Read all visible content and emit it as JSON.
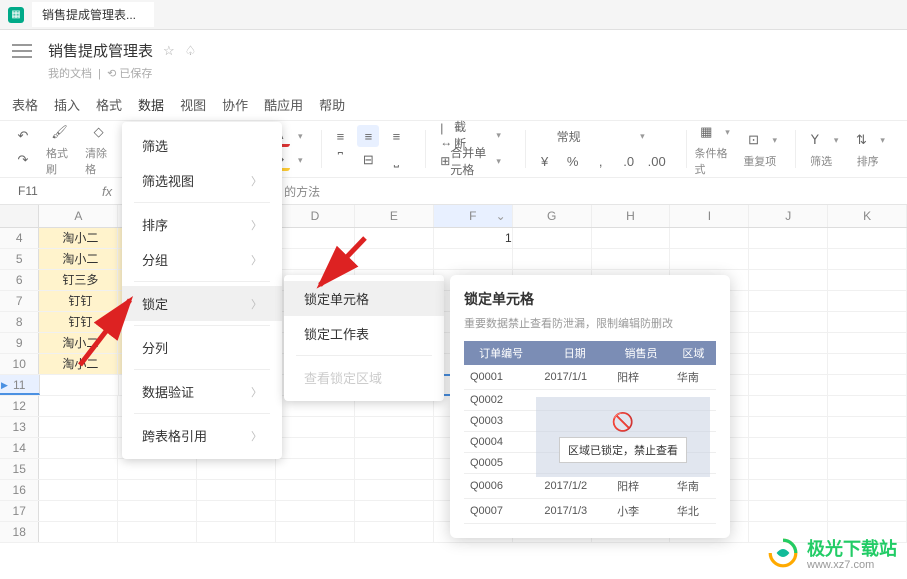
{
  "tab": {
    "title": "销售提成管理表..."
  },
  "header": {
    "title": "销售提成管理表",
    "sub_mydocs": "我的文档",
    "sub_saved": "已保存"
  },
  "menubar": [
    "表格",
    "插入",
    "格式",
    "数据",
    "视图",
    "协作",
    "酷应用",
    "帮助"
  ],
  "toolbar": {
    "format_brush": "格式刷",
    "clear_format": "清除格",
    "crop": "截断",
    "merge": "合并单元格",
    "normal": "常规",
    "cond_format": "条件格式",
    "dup": "重复项",
    "filter": "筛选",
    "sort": "排序"
  },
  "namebox": {
    "ref": "F11",
    "fx_hint": "的方法"
  },
  "columns": [
    "A",
    "B",
    "C",
    "D",
    "E",
    "F",
    "G",
    "H",
    "I",
    "J",
    "K"
  ],
  "col_a": [
    "淘小二",
    "淘小二",
    "钉三多",
    "钉钉",
    "钉钉",
    "淘小二",
    "淘小二"
  ],
  "f4_value": "1",
  "menu": {
    "filter": "筛选",
    "filter_view": "筛选视图",
    "sort": "排序",
    "group": "分组",
    "lock": "锁定",
    "split": "分列",
    "validate": "数据验证",
    "cross": "跨表格引用"
  },
  "submenu": {
    "lock_cell": "锁定单元格",
    "lock_sheet": "锁定工作表",
    "view_locked": "查看锁定区域"
  },
  "tooltip": {
    "title": "锁定单元格",
    "desc": "重要数据禁止查看防泄漏，限制编辑防删改",
    "headers": [
      "订单编号",
      "日期",
      "销售员",
      "区域"
    ],
    "rows": [
      [
        "Q0001",
        "2017/1/1",
        "阳梓",
        "华南"
      ],
      [
        "Q0002",
        "",
        "",
        ""
      ],
      [
        "Q0003",
        "",
        "",
        ""
      ],
      [
        "Q0004",
        "",
        "",
        ""
      ],
      [
        "Q0005",
        "",
        "",
        ""
      ],
      [
        "Q0006",
        "2017/1/2",
        "阳梓",
        "华南"
      ],
      [
        "Q0007",
        "2017/1/3",
        "小李",
        "华北"
      ]
    ],
    "lock_msg": "区域已锁定，禁止查看"
  },
  "watermark": {
    "name": "极光下载站",
    "url": "www.xz7.com"
  }
}
